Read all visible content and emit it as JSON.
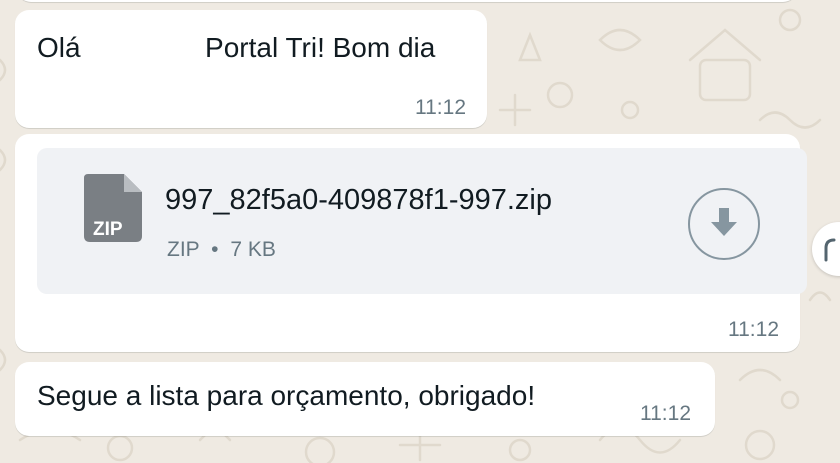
{
  "messages": [
    {
      "text": "Olá                Portal Tri! Bom dia",
      "time": "11:12"
    },
    {
      "file": {
        "name": "997_82f5a0-409878f1-997.zip",
        "type": "ZIP",
        "size": "7 KB",
        "icon_label": "ZIP"
      },
      "time": "11:12"
    },
    {
      "text": "Segue a lista para orçamento, obrigado!",
      "time": "11:12"
    }
  ],
  "icons": {
    "file": "zip-file-icon",
    "download": "download-icon",
    "menu": "chevron-down-icon",
    "side": "partial-round-button-icon"
  },
  "colors": {
    "background": "#efeae2",
    "bubble": "#ffffff",
    "file_card": "#f0f2f5",
    "time": "#667781"
  }
}
